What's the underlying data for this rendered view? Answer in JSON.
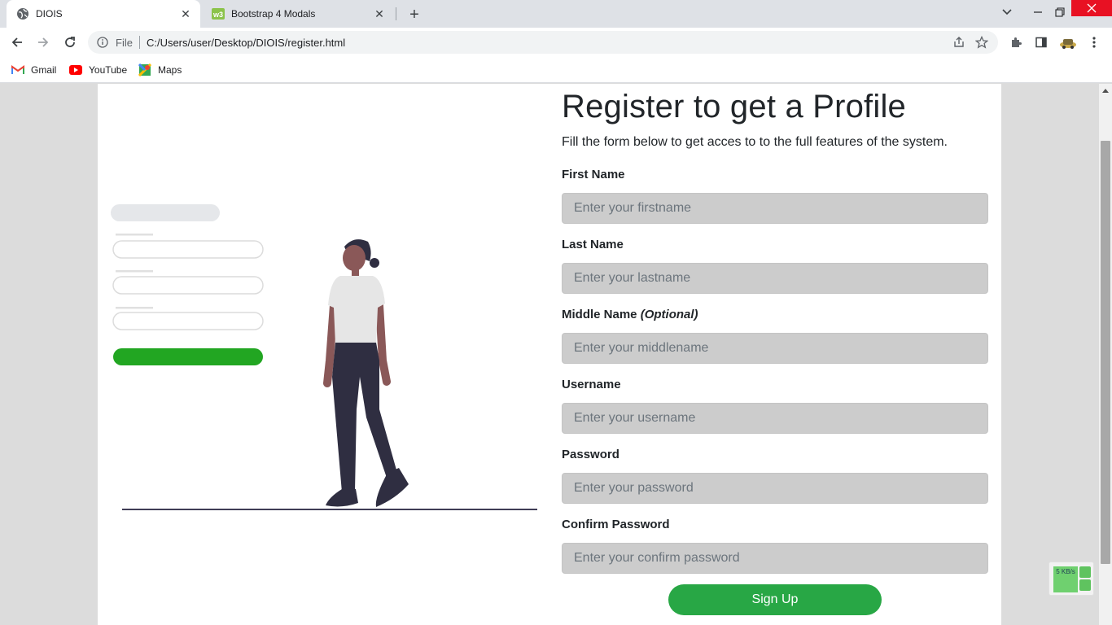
{
  "browser": {
    "tabs": [
      {
        "title": "DIOIS",
        "active": true
      },
      {
        "title": "Bootstrap 4 Modals",
        "active": false
      }
    ],
    "address": {
      "scheme_label": "File",
      "url": "C:/Users/user/Desktop/DIOIS/register.html"
    },
    "bookmarks": [
      {
        "label": "Gmail",
        "icon": "gmail-icon"
      },
      {
        "label": "YouTube",
        "icon": "youtube-icon"
      },
      {
        "label": "Maps",
        "icon": "maps-icon"
      }
    ]
  },
  "page": {
    "title": "Register to get a Profile",
    "subtitle": "Fill the form below to get acces to to the full features of the system.",
    "fields": [
      {
        "label": "First Name",
        "placeholder": "Enter your firstname"
      },
      {
        "label": "Last Name",
        "placeholder": "Enter your lastname"
      },
      {
        "label": "Middle Name",
        "label_suffix": "(Optional)",
        "placeholder": "Enter your middlename"
      },
      {
        "label": "Username",
        "placeholder": "Enter your username"
      },
      {
        "label": "Password",
        "placeholder": "Enter your password"
      },
      {
        "label": "Confirm Password",
        "placeholder": "Enter your confirm password"
      }
    ],
    "submit_label": "Sign Up"
  },
  "widget": {
    "text": "5 KB/s"
  },
  "colors": {
    "accent_green": "#28a745",
    "input_bg": "#cccccc",
    "page_bg": "#dcdcdc",
    "close_red": "#e81123"
  }
}
